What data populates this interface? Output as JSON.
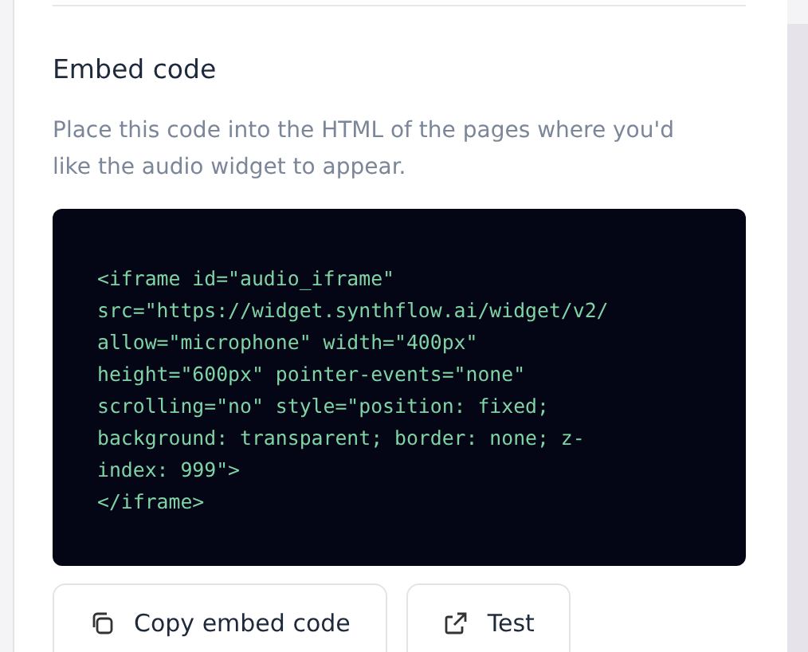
{
  "section": {
    "title": "Embed code",
    "description": "Place this code into the HTML of the pages where you'd like the audio widget to appear."
  },
  "code_lines": [
    "<iframe id=\"audio_iframe\"",
    "src=\"https://widget.synthflow.ai/widget/v2/",
    "allow=\"microphone\" width=\"400px\"",
    "height=\"600px\" pointer-events=\"none\"",
    "scrolling=\"no\" style=\"position: fixed;",
    "background: transparent; border: none; z-",
    "index: 999\">",
    "</iframe>"
  ],
  "buttons": [
    {
      "kind": "copy",
      "label": "Copy embed code"
    },
    {
      "kind": "external",
      "label": "Test"
    }
  ]
}
